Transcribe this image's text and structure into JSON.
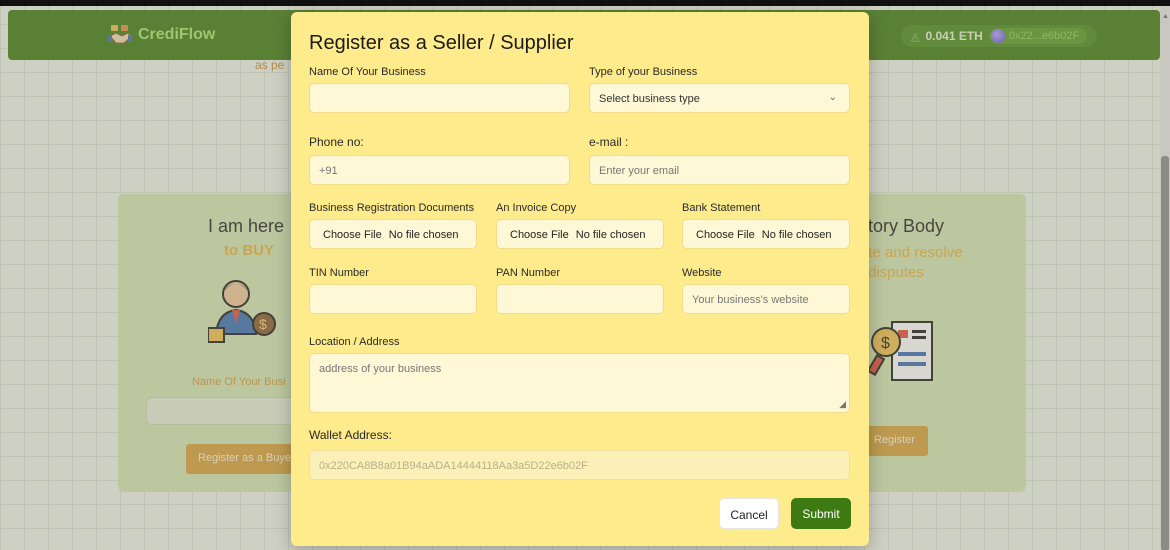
{
  "app": {
    "brand": "CrediFlow",
    "balance": "0.041 ETH",
    "address": "0x22...e6b02F",
    "eth_icon": "eth-diamond-icon",
    "colors": {
      "navbar": "#3f7a12",
      "modal": "#fdeb8c",
      "submit": "#3e7a12",
      "accent": "#d8a23a"
    }
  },
  "background": {
    "subtext": "as pe",
    "buyer_card": {
      "title": "I am here",
      "subtitle": "to BUY",
      "input_label": "Name Of Your Busi",
      "button": "Register as a Buye"
    },
    "regulator_card": {
      "title": "latory Body",
      "subtitle_line1": "ate and resolve",
      "subtitle_line2": "disputes",
      "button": "Register"
    }
  },
  "modal": {
    "title": "Register as a Seller / Supplier",
    "business_name": {
      "label": "Name Of Your Business",
      "value": ""
    },
    "business_type": {
      "label": "Type of your Business",
      "value": "Select business type"
    },
    "phone": {
      "label": "Phone no:",
      "placeholder": "+91"
    },
    "email": {
      "label": "e-mail :",
      "placeholder": "Enter your email"
    },
    "reg_docs": {
      "label": "Business Registration Documents",
      "choose": "Choose File",
      "status": "No file chosen"
    },
    "invoice": {
      "label": "An Invoice Copy",
      "choose": "Choose File",
      "status": "No file chosen"
    },
    "bank": {
      "label": "Bank Statement",
      "choose": "Choose File",
      "status": "No file chosen"
    },
    "tin": {
      "label": "TIN Number",
      "value": ""
    },
    "pan": {
      "label": "PAN Number",
      "value": ""
    },
    "website": {
      "label": "Website",
      "placeholder": "Your business's website"
    },
    "location": {
      "label": "Location / Address",
      "placeholder": "address of your business"
    },
    "wallet": {
      "label": "Wallet Address:",
      "value": "0x220CA8B8a01B94aADA14444118Aa3a5D22e6b02F"
    },
    "cancel": "Cancel",
    "submit": "Submit"
  }
}
